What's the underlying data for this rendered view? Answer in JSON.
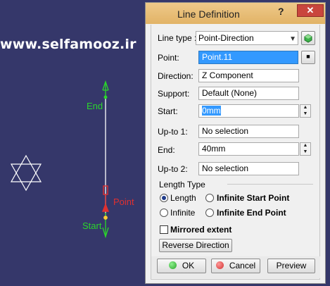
{
  "viewport": {
    "watermark": "www.selfamooz.ir",
    "labels": {
      "end": "End",
      "point": "Point",
      "start": "Start"
    },
    "colors": {
      "background": "#35376a",
      "green": "#2bd62b",
      "red": "#e03030",
      "white": "#ffffff"
    }
  },
  "dialog": {
    "title": "Line Definition",
    "help_glyph": "?",
    "close_glyph": "✕",
    "line_type": {
      "label": "Line type :",
      "value": "Point-Direction"
    },
    "point": {
      "label": "Point:",
      "value": "Point.11"
    },
    "direction": {
      "label": "Direction:",
      "value": "Z Component"
    },
    "support": {
      "label": "Support:",
      "value": "Default (None)"
    },
    "start": {
      "label": "Start:",
      "value": "0mm"
    },
    "upto1": {
      "label": "Up-to 1:",
      "value": "No selection"
    },
    "end": {
      "label": "End:",
      "value": "40mm"
    },
    "upto2": {
      "label": "Up-to 2:",
      "value": "No selection"
    },
    "length_type": {
      "label": "Length Type",
      "options": {
        "length": "Length",
        "infinite_start": "Infinite Start Point",
        "infinite": "Infinite",
        "infinite_end": "Infinite End Point"
      },
      "selected": "Length"
    },
    "mirrored": {
      "label": "Mirrored extent",
      "checked": false
    },
    "reverse": "Reverse Direction",
    "buttons": {
      "ok": "OK",
      "cancel": "Cancel",
      "preview": "Preview"
    },
    "colors": {
      "title_bar": "#e8bf78",
      "close": "#c9463d",
      "selection": "#3399ff",
      "ok_dot": "#2aa52a",
      "cancel_dot": "#d23030"
    }
  }
}
